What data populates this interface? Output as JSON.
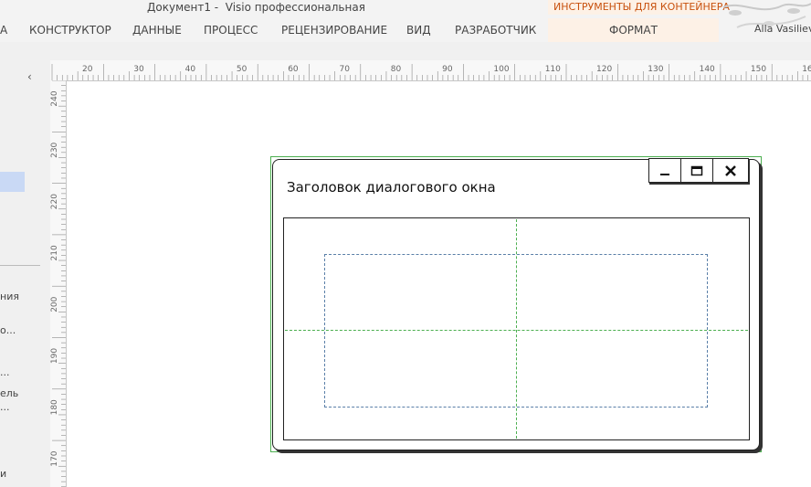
{
  "window": {
    "title": "Документ1 -  Visio профессиональная",
    "context_tab_group": "ИНСТРУМЕНТЫ ДЛЯ КОНТЕЙНЕРА",
    "user": "Alla Vasiliev"
  },
  "ribbon": {
    "tabs": [
      "А",
      "КОНСТРУКТОР",
      "ДАННЫЕ",
      "ПРОЦЕСС",
      "РЕЦЕНЗИРОВАНИЕ",
      "ВИД",
      "РАЗРАБОТЧИК"
    ],
    "context_tab": "ФОРМАТ"
  },
  "left_panel": {
    "collapse_glyph": "‹",
    "items": [
      "ния",
      "о...",
      "...",
      "ель",
      "...",
      "и"
    ]
  },
  "ruler": {
    "horizontal": [
      "20",
      "30",
      "40",
      "50",
      "60",
      "70",
      "80",
      "90",
      "100",
      "110",
      "120",
      "130",
      "140",
      "150",
      "160"
    ],
    "vertical": [
      "240",
      "230",
      "220",
      "210",
      "200",
      "190",
      "180",
      "170"
    ]
  },
  "shape": {
    "dialog_title": "Заголовок диалогового окна",
    "minimize_icon": "minimize-icon",
    "maximize_icon": "maximize-icon",
    "close_icon": "close-icon"
  },
  "colors": {
    "accent": "#c8510e",
    "selection": "#4caf50",
    "guide": "#4caf50",
    "inner_border": "#5a7fa8",
    "panel_selection": "#c9d9f5"
  }
}
